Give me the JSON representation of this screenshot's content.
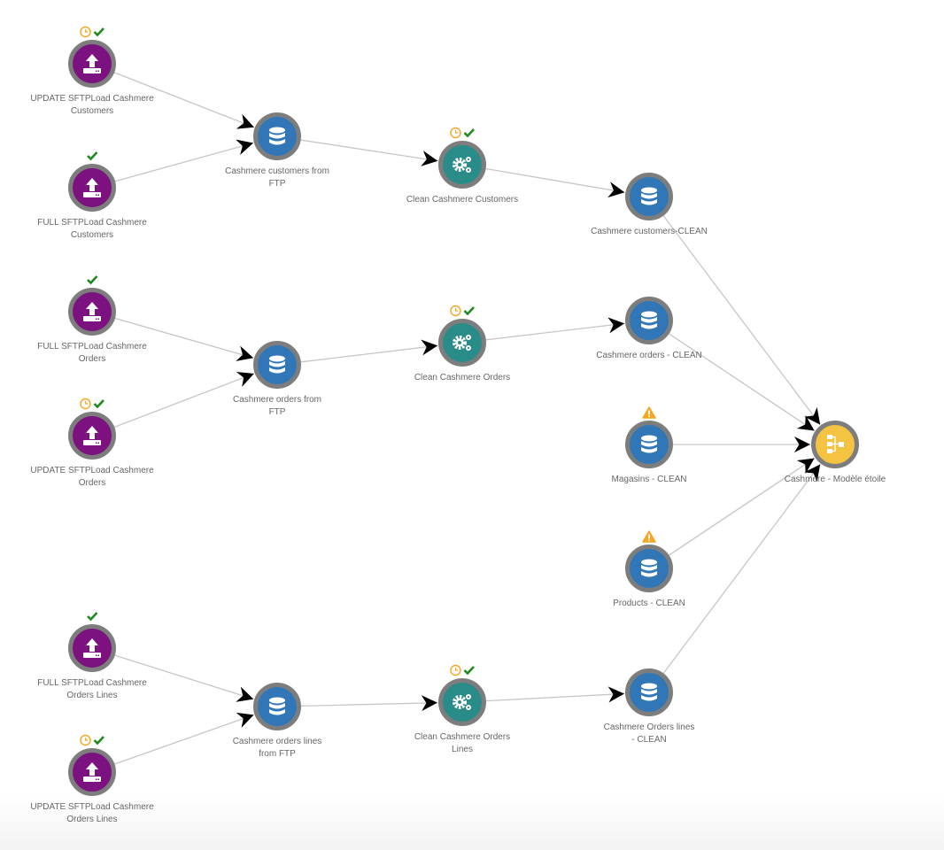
{
  "colors": {
    "source": "#7b1280",
    "dataset": "#3177b7",
    "recipe": "#2a8c88",
    "model": "#f5c342",
    "ring": "#7d7d7d",
    "clock": "#f5a623",
    "check": "#1e8a1e",
    "warning": "#f5a623"
  },
  "nodes": [
    {
      "id": "s1",
      "type": "source",
      "icon": "upload-icon",
      "label": [
        "UPDATE SFTPLoad Cashmere",
        "Customers"
      ],
      "badges": [
        "clock",
        "check"
      ]
    },
    {
      "id": "s2",
      "type": "source",
      "icon": "upload-icon",
      "label": [
        "FULL SFTPLoad Cashmere",
        "Customers"
      ],
      "badges": [
        "check"
      ]
    },
    {
      "id": "s3",
      "type": "source",
      "icon": "upload-icon",
      "label": [
        "FULL SFTPLoad Cashmere",
        "Orders"
      ],
      "badges": [
        "check"
      ]
    },
    {
      "id": "s4",
      "type": "source",
      "icon": "upload-icon",
      "label": [
        "UPDATE SFTPLoad Cashmere",
        "Orders"
      ],
      "badges": [
        "clock",
        "check"
      ]
    },
    {
      "id": "s5",
      "type": "source",
      "icon": "upload-icon",
      "label": [
        "FULL SFTPLoad Cashmere",
        "Orders Lines"
      ],
      "badges": [
        "check"
      ]
    },
    {
      "id": "s6",
      "type": "source",
      "icon": "upload-icon",
      "label": [
        "UPDATE SFTPLoad Cashmere",
        "Orders Lines"
      ],
      "badges": [
        "clock",
        "check"
      ]
    },
    {
      "id": "d1",
      "type": "dataset",
      "icon": "database-icon",
      "label": [
        "Cashmere customers from",
        "FTP"
      ],
      "badges": []
    },
    {
      "id": "d2",
      "type": "dataset",
      "icon": "database-icon",
      "label": [
        "Cashmere orders from",
        "FTP"
      ],
      "badges": []
    },
    {
      "id": "d3",
      "type": "dataset",
      "icon": "database-icon",
      "label": [
        "Cashmere orders lines",
        "from FTP"
      ],
      "badges": []
    },
    {
      "id": "r1",
      "type": "recipe",
      "icon": "gears-icon",
      "label": [
        "Clean Cashmere Customers"
      ],
      "badges": [
        "clock",
        "check"
      ]
    },
    {
      "id": "r2",
      "type": "recipe",
      "icon": "gears-icon",
      "label": [
        "Clean Cashmere Orders"
      ],
      "badges": [
        "clock",
        "check"
      ]
    },
    {
      "id": "r3",
      "type": "recipe",
      "icon": "gears-icon",
      "label": [
        "Clean Cashmere Orders",
        "Lines"
      ],
      "badges": [
        "clock",
        "check"
      ]
    },
    {
      "id": "c1",
      "type": "dataset",
      "icon": "database-icon",
      "label": [
        "Cashmere customers-CLEAN"
      ],
      "badges": []
    },
    {
      "id": "c2",
      "type": "dataset",
      "icon": "database-icon",
      "label": [
        "Cashmere orders - CLEAN"
      ],
      "badges": []
    },
    {
      "id": "c3",
      "type": "dataset",
      "icon": "database-icon",
      "label": [
        "Magasins - CLEAN"
      ],
      "badges": [
        "warning"
      ]
    },
    {
      "id": "c4",
      "type": "dataset",
      "icon": "database-icon",
      "label": [
        "Products - CLEAN"
      ],
      "badges": [
        "warning"
      ]
    },
    {
      "id": "c5",
      "type": "dataset",
      "icon": "database-icon",
      "label": [
        "Cashmere Orders lines",
        "- CLEAN"
      ],
      "badges": []
    },
    {
      "id": "m1",
      "type": "model",
      "icon": "hierarchy-icon",
      "label": [
        "Cashmere - Modèle étoile"
      ],
      "badges": []
    }
  ],
  "edges": [
    [
      "s1",
      "d1"
    ],
    [
      "s2",
      "d1"
    ],
    [
      "d1",
      "r1"
    ],
    [
      "r1",
      "c1"
    ],
    [
      "s3",
      "d2"
    ],
    [
      "s4",
      "d2"
    ],
    [
      "d2",
      "r2"
    ],
    [
      "r2",
      "c2"
    ],
    [
      "s5",
      "d3"
    ],
    [
      "s6",
      "d3"
    ],
    [
      "d3",
      "r3"
    ],
    [
      "r3",
      "c5"
    ],
    [
      "c1",
      "m1"
    ],
    [
      "c2",
      "m1"
    ],
    [
      "c3",
      "m1"
    ],
    [
      "c4",
      "m1"
    ],
    [
      "c5",
      "m1"
    ]
  ]
}
